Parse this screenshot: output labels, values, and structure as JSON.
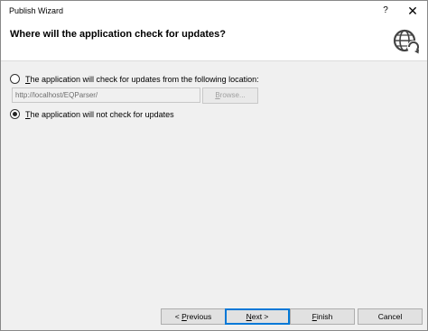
{
  "window": {
    "title": "Publish Wizard",
    "help_label": "?",
    "close_label": "✕"
  },
  "header": {
    "heading": "Where will the application check for updates?",
    "icon": "globe-refresh-icon"
  },
  "options": {
    "check_location": {
      "mnemonic": "T",
      "label_rest": "he application will check for updates from the following location:",
      "selected": false,
      "url_value": "http://localhost/EQParser/",
      "browse_mnemonic": "B",
      "browse_rest": "rowse..."
    },
    "no_check": {
      "mnemonic": "T",
      "label_rest": "he application will not check for updates",
      "selected": true
    }
  },
  "footer": {
    "previous": {
      "prefix": "< ",
      "mnemonic": "P",
      "rest": "revious"
    },
    "next": {
      "mnemonic": "N",
      "rest": "ext >"
    },
    "finish": {
      "mnemonic": "F",
      "rest": "inish"
    },
    "cancel": {
      "label": "Cancel"
    }
  }
}
